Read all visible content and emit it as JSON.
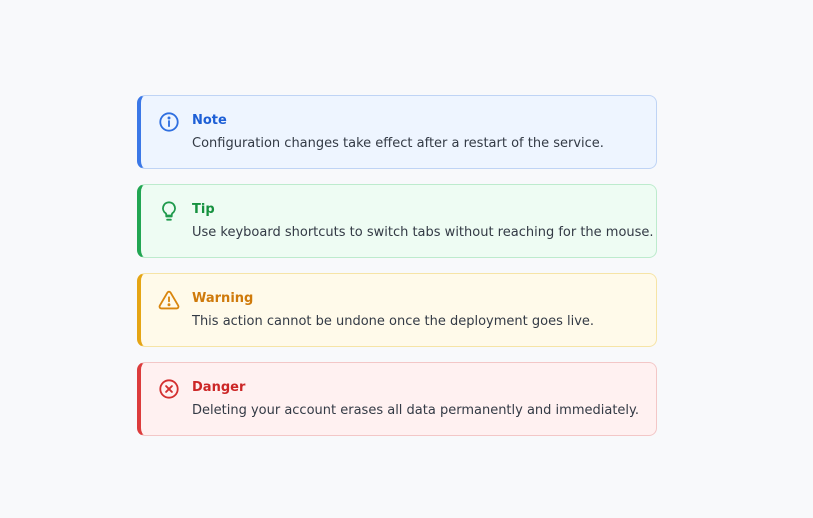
{
  "callouts": [
    {
      "type": "note",
      "title": "Note",
      "body": "Configuration changes take effect after a restart of the service.",
      "icon": "info-icon",
      "color": "#3b78e7"
    },
    {
      "type": "tip",
      "title": "Tip",
      "body": "Use keyboard shortcuts to switch tabs without reaching for the mouse.",
      "icon": "lightbulb-icon",
      "color": "#22a653"
    },
    {
      "type": "warning",
      "title": "Warning",
      "body": "This action cannot be undone once the deployment goes live.",
      "icon": "warning-triangle-icon",
      "color": "#e5a514"
    },
    {
      "type": "danger",
      "title": "Danger",
      "body": "Deleting your account erases all data permanently and immediately.",
      "icon": "error-circle-icon",
      "color": "#dc3c3c"
    }
  ]
}
